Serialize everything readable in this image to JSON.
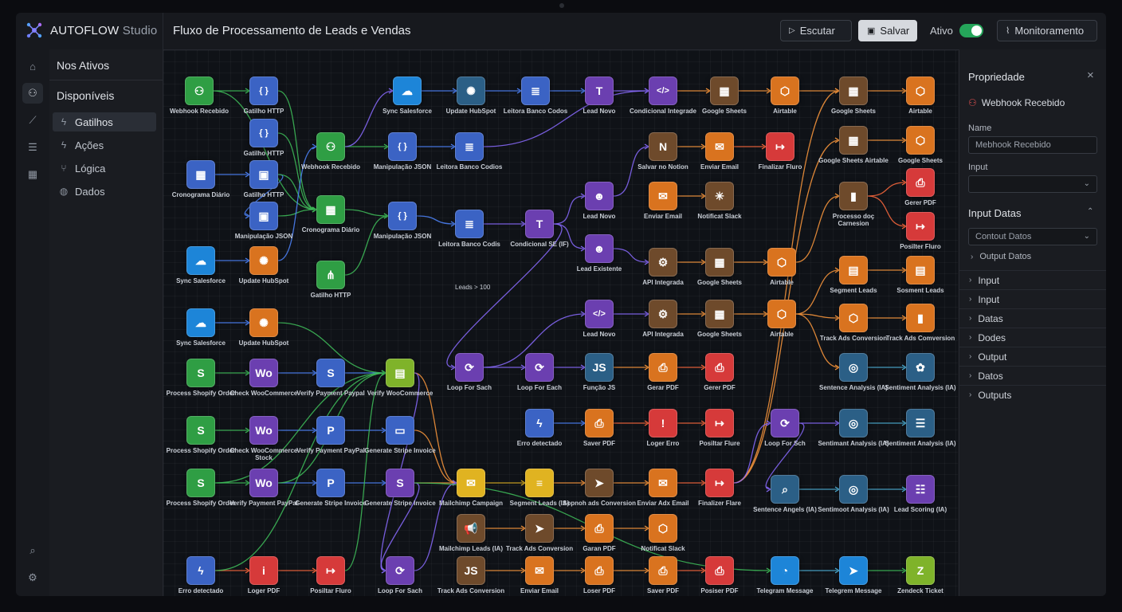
{
  "app": {
    "name": "AUTOFLOW",
    "suffix": "Studio"
  },
  "workflow_title": "Fluxo de Processamento de Leads e Vendas",
  "toolbar": {
    "run_label": "Escutar",
    "save_label": "Salvar",
    "active_label": "Ativo",
    "active_on": true,
    "monitor_label": "Monitoramento"
  },
  "sidebar": {
    "header": "Nos Ativos",
    "section": "Disponíveis",
    "items": [
      {
        "label": "Gatilhos",
        "icon": "bolt-icon"
      },
      {
        "label": "Ações",
        "icon": "bolt-icon"
      },
      {
        "label": "Lógica",
        "icon": "branch-icon"
      },
      {
        "label": "Dados",
        "icon": "database-icon"
      }
    ]
  },
  "colors": {
    "green": "#2f9e44",
    "blue": "#3b63c4",
    "purple": "#6b3fb0",
    "orange": "#d9731f",
    "red": "#d63a3a",
    "yellow": "#e0b321",
    "sky": "#1d85d8",
    "brown": "#6e4a2b",
    "lime": "#7fb32a",
    "teal": "#2b5f86"
  },
  "nodes": [
    {
      "id": "n1",
      "label": "Webhook Recebido",
      "icon": "webhook-icon",
      "color": "green"
    },
    {
      "id": "n2",
      "label": "Gatilho HTTP",
      "icon": "braces-icon",
      "color": "blue"
    },
    {
      "id": "n3",
      "label": "Gatilho HTTP",
      "icon": "braces-icon",
      "color": "blue"
    },
    {
      "id": "n4",
      "label": "Cronograma Diário",
      "icon": "calendar-icon",
      "color": "blue"
    },
    {
      "id": "n5",
      "label": "Gatilho HTTP",
      "icon": "chip-icon",
      "color": "blue"
    },
    {
      "id": "n6",
      "label": "Manipulação JSON",
      "icon": "chip-icon",
      "color": "blue"
    },
    {
      "id": "n7",
      "label": "Sync Salesforce",
      "icon": "salesforce-icon",
      "color": "sky"
    },
    {
      "id": "n8",
      "label": "Update HubSpot",
      "icon": "hubspot-icon",
      "color": "orange"
    },
    {
      "id": "n9",
      "label": "Sync Salesforce",
      "icon": "salesforce-icon",
      "color": "sky"
    },
    {
      "id": "n10",
      "label": "Update HubSpot",
      "icon": "hubspot-icon",
      "color": "orange"
    },
    {
      "id": "n11",
      "label": "Process Shopify Order",
      "icon": "shopify-icon",
      "color": "green"
    },
    {
      "id": "n12",
      "label": "Check WooCommerce",
      "icon": "woo-icon",
      "color": "purple"
    },
    {
      "id": "n13",
      "label": "Verify Payment Paypal",
      "icon": "stripe-icon",
      "color": "blue"
    },
    {
      "id": "n14",
      "label": "Verify WooCommerce",
      "icon": "inbox-icon",
      "color": "lime"
    },
    {
      "id": "n15",
      "label": "Process Shopify Order",
      "icon": "shopify-icon",
      "color": "green"
    },
    {
      "id": "n16",
      "label": "Check WooCommerce Stock",
      "icon": "woo-icon",
      "color": "purple"
    },
    {
      "id": "n17",
      "label": "Verify Payment PayPal",
      "icon": "paypal-icon",
      "color": "blue"
    },
    {
      "id": "n18",
      "label": "Generate Stripe Invoice",
      "icon": "card-icon",
      "color": "blue"
    },
    {
      "id": "n19",
      "label": "Process Shopify Order",
      "icon": "shopify-icon",
      "color": "green"
    },
    {
      "id": "n20",
      "label": "Verify Payment PayPal",
      "icon": "woo-icon",
      "color": "purple"
    },
    {
      "id": "n21",
      "label": "Generate Stripe Invoice",
      "icon": "paypal-icon",
      "color": "blue"
    },
    {
      "id": "n22",
      "label": "Generate Stripe Invoice",
      "icon": "stripe-icon",
      "color": "purple"
    },
    {
      "id": "n23",
      "label": "Erro detectado",
      "icon": "bolt-icon",
      "color": "blue"
    },
    {
      "id": "n24",
      "label": "Loger PDF",
      "icon": "info-icon",
      "color": "red"
    },
    {
      "id": "n25",
      "label": "Posiltar Fluro",
      "icon": "exit-icon",
      "color": "red"
    },
    {
      "id": "n26",
      "label": "Loop For Sach",
      "icon": "loop-icon",
      "color": "purple"
    },
    {
      "id": "n27",
      "label": "Webhook Recebido",
      "icon": "webhook-icon",
      "color": "green"
    },
    {
      "id": "n28",
      "label": "Cronograma Diário",
      "icon": "calendar-icon",
      "color": "green"
    },
    {
      "id": "n29",
      "label": "Gatilho HTTP",
      "icon": "share-icon",
      "color": "green"
    },
    {
      "id": "n30",
      "label": "Sync Salesforce",
      "icon": "salesforce-icon",
      "color": "sky"
    },
    {
      "id": "n31",
      "label": "Manipulação JSON",
      "icon": "braces-icon",
      "color": "blue"
    },
    {
      "id": "n32",
      "label": "Manipulação JSON",
      "icon": "braces-icon",
      "color": "blue"
    },
    {
      "id": "n33",
      "label": "Update HubSpot",
      "icon": "hubspot-icon",
      "color": "teal"
    },
    {
      "id": "n34",
      "label": "Leitora Banco Codos",
      "icon": "database-icon",
      "color": "blue"
    },
    {
      "id": "n35",
      "label": "Leitora Banco Codios",
      "icon": "database-icon",
      "color": "blue"
    },
    {
      "id": "n36",
      "label": "Leitora Banco Codis",
      "icon": "database-icon",
      "color": "blue"
    },
    {
      "id": "n37",
      "label": "Lead Novo",
      "icon": "text-icon",
      "color": "purple"
    },
    {
      "id": "n38",
      "label": "Condicional SE (IF)",
      "icon": "text-icon",
      "color": "purple"
    },
    {
      "id": "n39",
      "label": "Lead Novo",
      "icon": "users-icon",
      "color": "purple"
    },
    {
      "id": "n40",
      "label": "Lead Existente",
      "icon": "users-icon",
      "color": "purple"
    },
    {
      "id": "n41",
      "label": "Lead Novo",
      "icon": "code-icon",
      "color": "purple"
    },
    {
      "id": "n42",
      "label": "Loop For Sach",
      "icon": "loop-icon",
      "color": "purple"
    },
    {
      "id": "n43",
      "label": "Loop For Each",
      "icon": "loop-icon",
      "color": "purple"
    },
    {
      "id": "n44",
      "label": "Função JS",
      "icon": "js-icon",
      "color": "teal"
    },
    {
      "id": "n45",
      "label": "Erro detectado",
      "icon": "bolt-icon",
      "color": "blue"
    },
    {
      "id": "n46",
      "label": "Saver PDF",
      "icon": "pdf-icon",
      "color": "orange"
    },
    {
      "id": "n47",
      "label": "Mailchimp Campaign",
      "icon": "mailchimp-icon",
      "color": "yellow"
    },
    {
      "id": "n48",
      "label": "Segment Leads (IA)",
      "icon": "segment-icon",
      "color": "yellow"
    },
    {
      "id": "n49",
      "label": "Mailchimp Leads (IA)",
      "icon": "megaphone-icon",
      "color": "brown"
    },
    {
      "id": "n50",
      "label": "Track Ads Conversion",
      "icon": "send-icon",
      "color": "brown"
    },
    {
      "id": "n51",
      "label": "Track Ads Conversion",
      "icon": "js-icon",
      "color": "brown"
    },
    {
      "id": "n52",
      "label": "Enviar Email",
      "icon": "mail-icon",
      "color": "orange"
    },
    {
      "id": "n53",
      "label": "Condicional Integrade",
      "icon": "code-icon",
      "color": "purple"
    },
    {
      "id": "n54",
      "label": "Salvar no Notion",
      "icon": "notion-icon",
      "color": "brown"
    },
    {
      "id": "n55",
      "label": "Enviar Email",
      "icon": "mail-icon",
      "color": "orange"
    },
    {
      "id": "n56",
      "label": "API Integrada",
      "icon": "gear-icon",
      "color": "brown"
    },
    {
      "id": "n57",
      "label": "API Integrada",
      "icon": "gear-icon",
      "color": "brown"
    },
    {
      "id": "n58",
      "label": "Gerar PDF",
      "icon": "pdf-icon",
      "color": "orange"
    },
    {
      "id": "n59",
      "label": "Loger Erro",
      "icon": "alert-icon",
      "color": "red"
    },
    {
      "id": "n60",
      "label": "Sopnoh ads Conversion",
      "icon": "send-icon",
      "color": "brown"
    },
    {
      "id": "n61",
      "label": "Garan PDF",
      "icon": "pdf-icon",
      "color": "orange"
    },
    {
      "id": "n62",
      "label": "Loser PDF",
      "icon": "pdf-icon",
      "color": "orange"
    },
    {
      "id": "n63",
      "label": "Google Sheets",
      "icon": "sheets-icon",
      "color": "brown"
    },
    {
      "id": "n64",
      "label": "Enviar Email",
      "icon": "mail-icon",
      "color": "orange"
    },
    {
      "id": "n65",
      "label": "Notificat Slack",
      "icon": "slack-icon",
      "color": "brown"
    },
    {
      "id": "n66",
      "label": "Google Sheets",
      "icon": "sheets-icon",
      "color": "brown"
    },
    {
      "id": "n67",
      "label": "Google Sheets",
      "icon": "sheets-icon",
      "color": "brown"
    },
    {
      "id": "n68",
      "label": "Gerer PDF",
      "icon": "pdf-icon",
      "color": "red"
    },
    {
      "id": "n69",
      "label": "Posiltar Flure",
      "icon": "exit-icon",
      "color": "red"
    },
    {
      "id": "n70",
      "label": "Enviar Adx Email",
      "icon": "mail-icon",
      "color": "orange"
    },
    {
      "id": "n71",
      "label": "Notificat Slack",
      "icon": "box-icon",
      "color": "orange"
    },
    {
      "id": "n72",
      "label": "Saver PDF",
      "icon": "pdf-icon",
      "color": "orange"
    },
    {
      "id": "n73",
      "label": "Airtable",
      "icon": "box-icon",
      "color": "orange"
    },
    {
      "id": "n74",
      "label": "Finalizar Fluro",
      "icon": "exit-icon",
      "color": "red"
    },
    {
      "id": "n75",
      "label": "Airtable",
      "icon": "box-icon",
      "color": "orange"
    },
    {
      "id": "n76",
      "label": "Airtable",
      "icon": "box-icon",
      "color": "orange"
    },
    {
      "id": "n77",
      "label": "Finalizer Flare",
      "icon": "exit-icon",
      "color": "red"
    },
    {
      "id": "n78",
      "label": "Posiser PDF",
      "icon": "pdf-icon",
      "color": "red"
    },
    {
      "id": "n79",
      "label": "Loop For Sch",
      "icon": "loop-icon",
      "color": "purple"
    },
    {
      "id": "n80",
      "label": "Sentence Angels (IA)",
      "icon": "doc-search-icon",
      "color": "teal"
    },
    {
      "id": "n81",
      "label": "Telegram Message",
      "icon": "messenger-icon",
      "color": "sky"
    },
    {
      "id": "n82",
      "label": "Google Sheets",
      "icon": "sheets-icon",
      "color": "brown"
    },
    {
      "id": "n83",
      "label": "Google Sheets Airtable",
      "icon": "sheets-icon",
      "color": "brown"
    },
    {
      "id": "n84",
      "label": "Processo doç Carnesion",
      "icon": "chart-icon",
      "color": "brown"
    },
    {
      "id": "n85",
      "label": "Segment Leads",
      "icon": "clipboard-icon",
      "color": "orange"
    },
    {
      "id": "n86",
      "label": "Track Ads Conversion",
      "icon": "box-icon",
      "color": "orange"
    },
    {
      "id": "n87",
      "label": "Sentence Analysis (IA)",
      "icon": "globe-icon",
      "color": "teal"
    },
    {
      "id": "n88",
      "label": "Sentimant Analysis (IA)",
      "icon": "globe-icon",
      "color": "teal"
    },
    {
      "id": "n89",
      "label": "Sentimoot Analysis (IA)",
      "icon": "globe-icon",
      "color": "teal"
    },
    {
      "id": "n90",
      "label": "Telegrem Message",
      "icon": "telegram-icon",
      "color": "sky"
    },
    {
      "id": "n91",
      "label": "Airtable",
      "icon": "box-icon",
      "color": "orange"
    },
    {
      "id": "n92",
      "label": "Google Sheets",
      "icon": "box-icon",
      "color": "orange"
    },
    {
      "id": "n93",
      "label": "Gerer PDF",
      "icon": "pdf-icon",
      "color": "red"
    },
    {
      "id": "n94",
      "label": "Posilter Fluro",
      "icon": "exit-icon",
      "color": "red"
    },
    {
      "id": "n95",
      "label": "Sosment Leads",
      "icon": "clipboard-icon",
      "color": "orange"
    },
    {
      "id": "n96",
      "label": "Track Ads Comversion",
      "icon": "chart-icon",
      "color": "orange"
    },
    {
      "id": "n97",
      "label": "Sentiment Analysis (IA)",
      "icon": "brain-icon",
      "color": "teal"
    },
    {
      "id": "n98",
      "label": "Sentiment Analysis (IA)",
      "icon": "lines-icon",
      "color": "teal"
    },
    {
      "id": "n99",
      "label": "Lead Scoring (IA)",
      "icon": "list-icon",
      "color": "purple"
    },
    {
      "id": "n100",
      "label": "Zendeck Ticket",
      "icon": "zendesk-icon",
      "color": "lime"
    }
  ],
  "edge_label": "Leads > 100",
  "properties": {
    "title": "Propriedade",
    "node_name": "Webhook Recebido",
    "name_label": "Name",
    "name_value": "Mebhook Recebido",
    "input_label": "Input",
    "input_value": "",
    "section_title": "Input Datas",
    "select_value": "Contout Datos",
    "rows": [
      "Output Datos",
      "Input",
      "Input",
      "Datas",
      "Dodes",
      "Output",
      "Datos",
      "Outputs"
    ]
  }
}
